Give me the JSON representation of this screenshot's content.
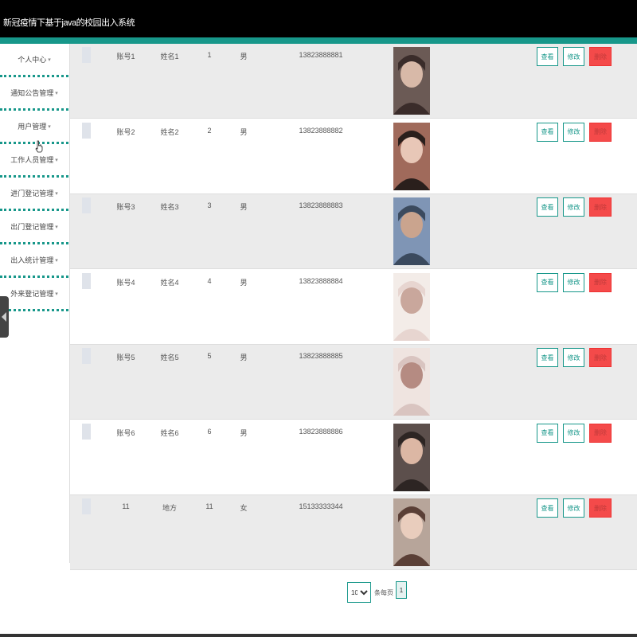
{
  "header": {
    "title": "新冠疫情下基于java的校园出入系统"
  },
  "sidebar": {
    "items": [
      {
        "label": "个人中心",
        "arrow": "▾"
      },
      {
        "label": "通知公告管理",
        "arrow": "▾"
      },
      {
        "label": "用户管理",
        "arrow": "▾"
      },
      {
        "label": "工作人员管理",
        "arrow": "▾"
      },
      {
        "label": "进门登记管理",
        "arrow": "▾"
      },
      {
        "label": "出门登记管理",
        "arrow": "▾"
      },
      {
        "label": "出入统计管理",
        "arrow": "▾"
      },
      {
        "label": "外来登记管理",
        "arrow": "▾"
      }
    ]
  },
  "table": {
    "rows": [
      {
        "account": "账号1",
        "name": "姓名1",
        "age": "1",
        "sex": "男",
        "phone": "13823888881"
      },
      {
        "account": "账号2",
        "name": "姓名2",
        "age": "2",
        "sex": "男",
        "phone": "13823888882"
      },
      {
        "account": "账号3",
        "name": "姓名3",
        "age": "3",
        "sex": "男",
        "phone": "13823888883"
      },
      {
        "account": "账号4",
        "name": "姓名4",
        "age": "4",
        "sex": "男",
        "phone": "13823888884"
      },
      {
        "account": "账号5",
        "name": "姓名5",
        "age": "5",
        "sex": "男",
        "phone": "13823888885"
      },
      {
        "account": "账号6",
        "name": "姓名6",
        "age": "6",
        "sex": "男",
        "phone": "13823888886"
      },
      {
        "account": "11",
        "name": "地方",
        "age": "11",
        "sex": "女",
        "phone": "15133333344"
      }
    ],
    "actions": {
      "view": "查看",
      "edit": "修改",
      "delete": "删除"
    }
  },
  "pagination": {
    "page_size": "10",
    "per_page_label": "条每页",
    "current_page": "1"
  },
  "colors": {
    "accent": "#17978a",
    "header_bg": "#000000",
    "delete_btn": "#f44a4a",
    "row_shade": "#ebebeb"
  },
  "icons": {
    "collapse": "chevron-left-icon",
    "cursor": "hand-pointer-icon"
  }
}
